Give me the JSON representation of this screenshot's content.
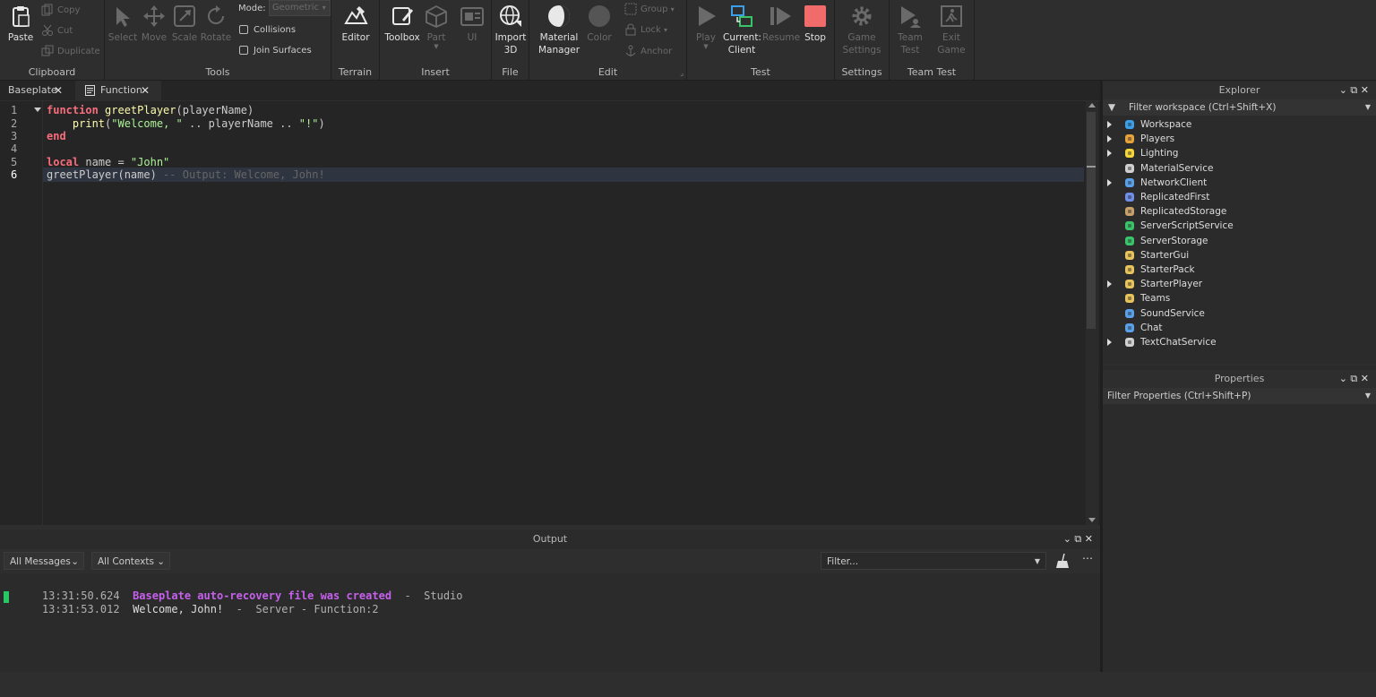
{
  "ribbon": {
    "clipboard": {
      "label": "Clipboard",
      "paste": "Paste",
      "copy": "Copy",
      "cut": "Cut",
      "duplicate": "Duplicate"
    },
    "tools": {
      "label": "Tools",
      "select": "Select",
      "move": "Move",
      "scale": "Scale",
      "rotate": "Rotate",
      "mode_label": "Mode:",
      "mode_value": "Geometric",
      "collisions": "Collisions",
      "join_surfaces": "Join Surfaces"
    },
    "terrain": {
      "label": "Terrain",
      "editor": "Editor"
    },
    "insert": {
      "label": "Insert",
      "toolbox": "Toolbox",
      "part": "Part",
      "ui": "UI"
    },
    "file": {
      "label": "File",
      "import3d_1": "Import",
      "import3d_2": "3D"
    },
    "edit": {
      "label": "Edit",
      "material_1": "Material",
      "material_2": "Manager",
      "color": "Color",
      "group": "Group",
      "lock": "Lock",
      "anchor": "Anchor"
    },
    "test": {
      "label": "Test",
      "play": "Play",
      "current_1": "Current:",
      "current_2": "Client",
      "resume": "Resume",
      "stop": "Stop"
    },
    "settings": {
      "label": "Settings",
      "game_1": "Game",
      "game_2": "Settings"
    },
    "teamtest": {
      "label": "Team Test",
      "team_1": "Team",
      "team_2": "Test",
      "exit_1": "Exit",
      "exit_2": "Game"
    }
  },
  "tabs": [
    {
      "label": "Baseplate"
    },
    {
      "label": "Function"
    }
  ],
  "editor": {
    "line_numbers": [
      "1",
      "2",
      "3",
      "4",
      "5",
      "6"
    ],
    "line1": {
      "kw": "function",
      "fn": "greetPlayer",
      "rest": "(playerName)"
    },
    "line2": {
      "indent": "    ",
      "fn": "print",
      "open": "(",
      "str": "\"Welcome, \"",
      "mid": " .. playerName .. ",
      "str2": "\"!\"",
      "close": ")"
    },
    "line3": {
      "kw": "end"
    },
    "line5": {
      "kw": "local",
      "mid": " name = ",
      "str": "\"John\""
    },
    "line6": {
      "code": "greetPlayer(name) ",
      "comment": "-- Output: Welcome, John!"
    }
  },
  "output": {
    "title": "Output",
    "messages_filter": "All Messages",
    "contexts_filter": "All Contexts",
    "filter_placeholder": "Filter...",
    "lines": [
      {
        "time": "13:31:50.624",
        "text": "Baseplate auto-recovery file was created",
        "sep": "  -  ",
        "source": "Studio"
      },
      {
        "time": "13:31:53.012",
        "text": "Welcome, John!",
        "sep": "  -  ",
        "source": "Server - Function:2"
      }
    ]
  },
  "explorer": {
    "title": "Explorer",
    "filter": "Filter workspace (Ctrl+Shift+X)",
    "items": [
      {
        "label": "Workspace",
        "icon": "globe-icon",
        "color": "#3a9ee8",
        "expand": true
      },
      {
        "label": "Players",
        "icon": "players-icon",
        "color": "#e8a23a",
        "expand": true
      },
      {
        "label": "Lighting",
        "icon": "bulb-icon",
        "color": "#f5d63a",
        "expand": true
      },
      {
        "label": "MaterialService",
        "icon": "material-icon",
        "color": "#d0d0d0",
        "expand": false
      },
      {
        "label": "NetworkClient",
        "icon": "network-icon",
        "color": "#5aa0e8",
        "expand": true
      },
      {
        "label": "ReplicatedFirst",
        "icon": "replicated-first-icon",
        "color": "#6f8fe8",
        "expand": false
      },
      {
        "label": "ReplicatedStorage",
        "icon": "replicated-storage-icon",
        "color": "#c8a06a",
        "expand": false
      },
      {
        "label": "ServerScriptService",
        "icon": "server-script-icon",
        "color": "#3ac46a",
        "expand": false
      },
      {
        "label": "ServerStorage",
        "icon": "server-storage-icon",
        "color": "#3ac46a",
        "expand": false
      },
      {
        "label": "StarterGui",
        "icon": "starter-gui-icon",
        "color": "#e8c25a",
        "expand": false
      },
      {
        "label": "StarterPack",
        "icon": "starter-pack-icon",
        "color": "#e8c25a",
        "expand": false
      },
      {
        "label": "StarterPlayer",
        "icon": "starter-player-icon",
        "color": "#e8c25a",
        "expand": true
      },
      {
        "label": "Teams",
        "icon": "teams-icon",
        "color": "#e8c25a",
        "expand": false
      },
      {
        "label": "SoundService",
        "icon": "sound-icon",
        "color": "#5aa0e8",
        "expand": false
      },
      {
        "label": "Chat",
        "icon": "chat-icon",
        "color": "#5aa0e8",
        "expand": false
      },
      {
        "label": "TextChatService",
        "icon": "text-chat-icon",
        "color": "#d0d0d0",
        "expand": true
      }
    ]
  },
  "properties": {
    "title": "Properties",
    "filter": "Filter Properties (Ctrl+Shift+P)"
  },
  "colors": {
    "accent": "#3a9ee8",
    "stop": "#f26b6b",
    "output_highlight": "#c561ec",
    "marker": "#27c766"
  }
}
